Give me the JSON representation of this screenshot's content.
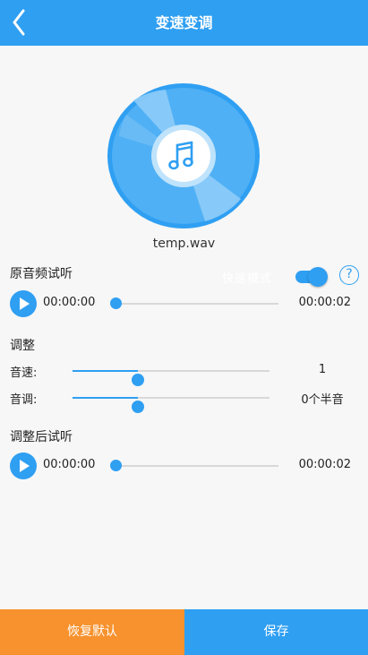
{
  "header": {
    "title": "变速变调",
    "back_icon": "back-chevron-icon"
  },
  "file": {
    "name": "temp.wav",
    "disc_icon": "music-note-icon"
  },
  "original": {
    "label": "原音频试听",
    "toggle_label": "快速模式",
    "toggle_on": true,
    "help_icon": "?",
    "current_time": "00:00:00",
    "total_time": "00:00:02",
    "progress": 0
  },
  "adjust": {
    "label": "调整",
    "speed": {
      "label": "音速:",
      "value": "1",
      "level": 0.33
    },
    "pitch": {
      "label": "音调:",
      "value": "0个半音",
      "level": 0.33
    }
  },
  "adjusted": {
    "label": "调整后试听",
    "current_time": "00:00:00",
    "total_time": "00:00:02",
    "progress": 0
  },
  "footer": {
    "reset_label": "恢复默认",
    "save_label": "保存"
  },
  "colors": {
    "primary": "#2f9ff2",
    "accent_orange": "#f7922e",
    "background": "#f7f7f7"
  }
}
